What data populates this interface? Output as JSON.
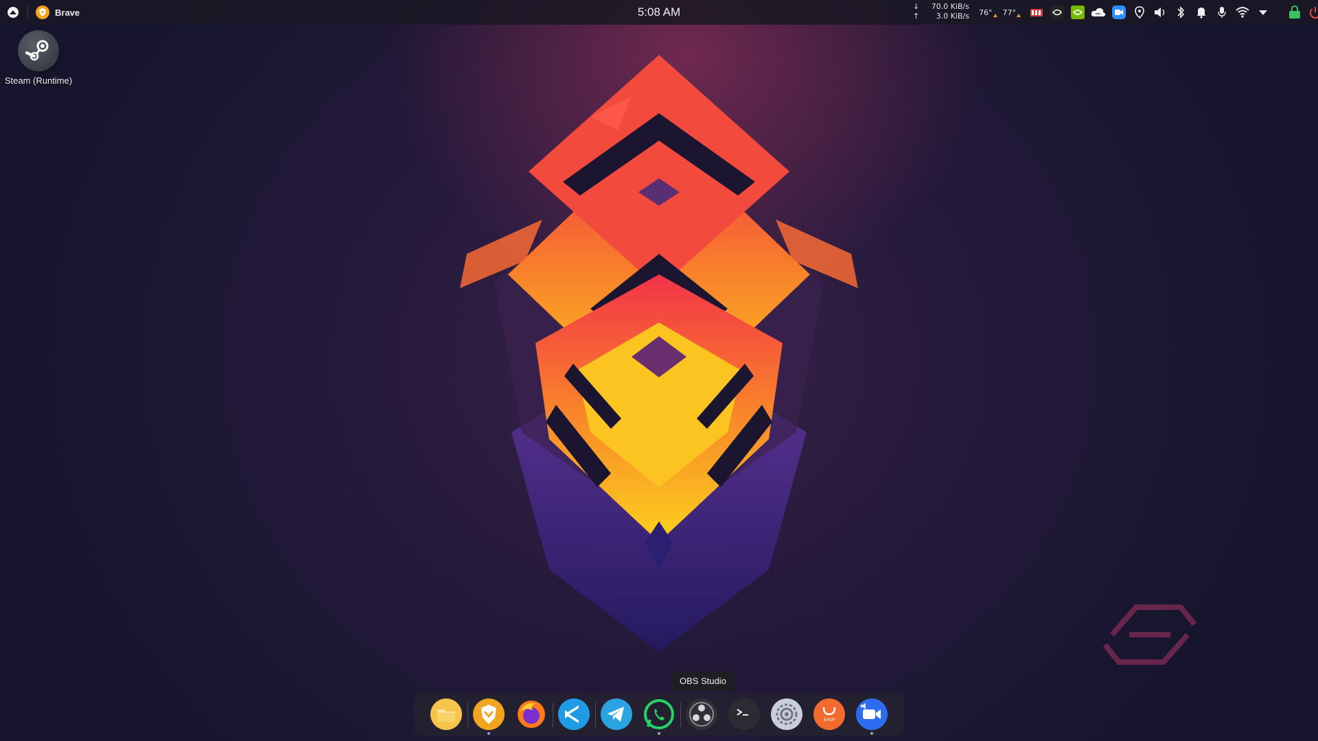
{
  "top_panel": {
    "active_app_label": "Brave",
    "clock": "5:08 AM",
    "network": {
      "down_arrow": "↓",
      "down_rate": "70.0 KiB/s",
      "up_arrow": "↑",
      "up_rate": "3.0 KiB/s"
    },
    "temps": [
      "76°",
      "77°"
    ],
    "tray_icons": [
      "memory-monitor-icon",
      "nvidia-settings-icon",
      "nvidia-prime-icon",
      "weather-cloud-icon",
      "zoom-icon",
      "location-pin-icon",
      "volume-icon",
      "bluetooth-icon",
      "notifications-icon",
      "microphone-icon",
      "wifi-icon",
      "tray-expand-icon",
      "lock-icon",
      "power-icon"
    ]
  },
  "desktop": {
    "icons": [
      {
        "label": "Steam (Runtime)",
        "icon": "steam-icon"
      }
    ]
  },
  "dock": {
    "tooltip": "OBS Studio",
    "items": [
      {
        "name": "files-icon",
        "color": "#f6c44a"
      },
      {
        "name": "brave-icon",
        "color": "#f0a420"
      },
      {
        "name": "firefox-icon",
        "color": "#ff7a1a"
      },
      {
        "name": "vscode-icon",
        "color": "#1f9be6"
      },
      {
        "name": "telegram-icon",
        "color": "#2aa3e0"
      },
      {
        "name": "whatsapp-icon",
        "color": "#25d366"
      },
      {
        "name": "obs-studio-icon",
        "color": "#303036"
      },
      {
        "name": "terminal-icon",
        "color": "#2b2b33"
      },
      {
        "name": "system-settings-icon",
        "color": "#c9ced8"
      },
      {
        "name": "software-shop-icon",
        "color": "#f26a2e"
      },
      {
        "name": "zoom-icon",
        "color": "#2d6cf0"
      }
    ],
    "shop_label": "SHOP"
  },
  "colors": {
    "panel_bg": "#1a1824",
    "accent_blue": "#7aa2ff",
    "art_red": "#f0453a",
    "art_orange": "#f8812e",
    "art_yellow": "#fbd21e",
    "art_purple": "#4a2f8a"
  }
}
